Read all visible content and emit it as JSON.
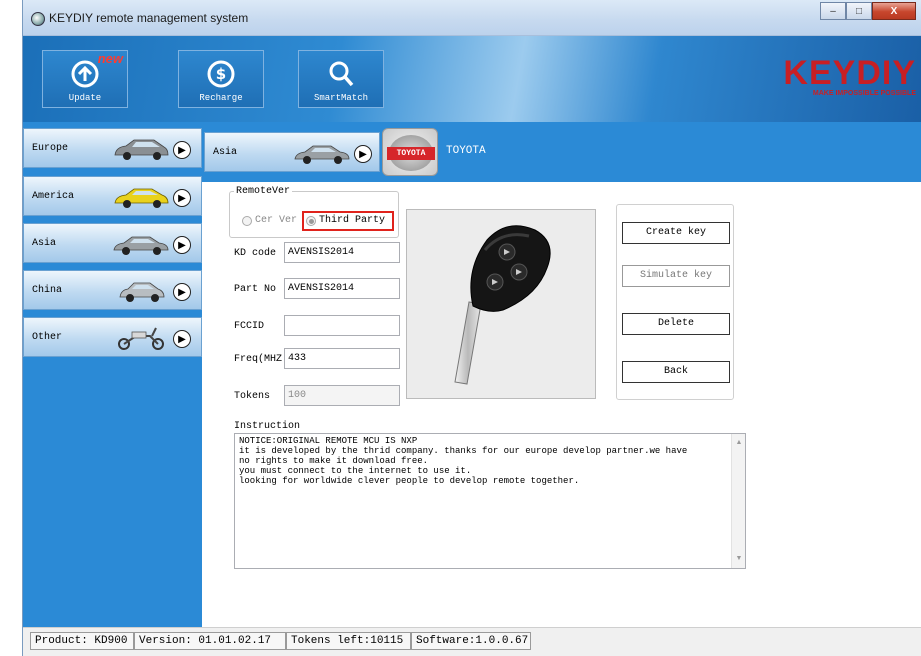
{
  "window": {
    "title": "KEYDIY remote management system",
    "controls": {
      "minimize": "–",
      "maximize": "□",
      "close": "X"
    }
  },
  "toolbar": {
    "update": {
      "label": "Update",
      "badge": "new",
      "icon": "arrow-up-circle-icon"
    },
    "recharge": {
      "label": "Recharge",
      "icon": "dollar-circle-icon"
    },
    "smartmatch": {
      "label": "SmartMatch",
      "icon": "magnifier-icon"
    },
    "logo": {
      "text": "KEYDIY",
      "tagline": "MAKE IMPOSSIBLE POSSIBLE",
      "color": "#c81f24"
    }
  },
  "sidebar": {
    "items": [
      {
        "label": "Europe",
        "icon": "hatchback-car-icon"
      },
      {
        "label": "America",
        "icon": "yellow-car-icon"
      },
      {
        "label": "Asia",
        "icon": "sedan-car-icon"
      },
      {
        "label": "China",
        "icon": "small-car-icon"
      },
      {
        "label": "Other",
        "icon": "scooter-icon"
      }
    ]
  },
  "main": {
    "region": "Asia",
    "brand_badge": "TOYOTA",
    "brand_name": "TOYOTA"
  },
  "form": {
    "remotever_legend": "RemoteVer",
    "radio_cer": "Cer Ver",
    "radio_third": "Third Party",
    "kd_code_label": "KD code",
    "kd_code_value": "AVENSIS2014",
    "part_no_label": "Part No",
    "part_no_value": "AVENSIS2014",
    "fccid_label": "FCCID",
    "fccid_value": "",
    "freq_label": "Freq(MHZ",
    "freq_value": "433",
    "tokens_label": "Tokens",
    "tokens_value": "100"
  },
  "actions": {
    "create_key": "Create key",
    "simulate_key": "Simulate key",
    "delete": "Delete",
    "back": "Back"
  },
  "instruction": {
    "label": "Instruction",
    "text": "NOTICE:ORIGINAL REMOTE MCU IS NXP\nit is developed by the thrid company. thanks for our europe develop partner.we have\nno rights to make it download free.\nyou must connect to the internet to use it.\nlooking for worldwide clever people to develop remote together."
  },
  "status": {
    "product": "Product: KD900",
    "version": "Version: 01.01.02.17",
    "tokens_left": "Tokens left:10115",
    "software": "Software:1.0.0.67"
  },
  "colors": {
    "accent_blue": "#2b8ad6",
    "highlight_red": "#e0231c"
  }
}
